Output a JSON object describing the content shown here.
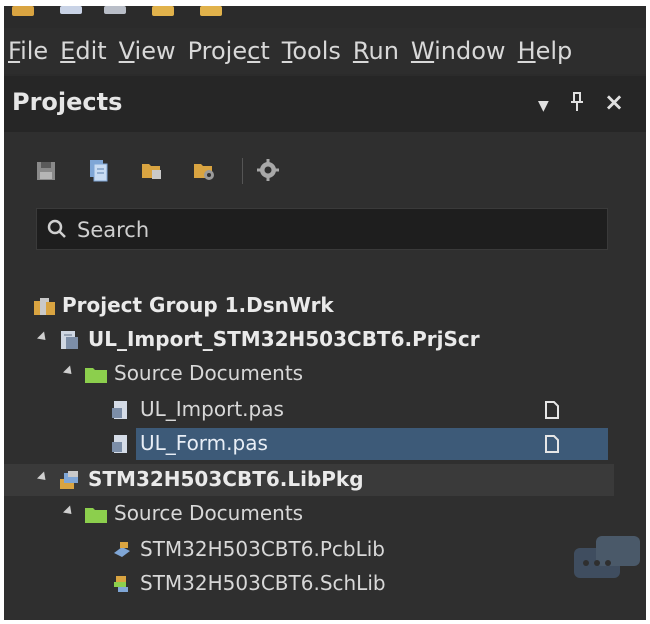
{
  "menubar": {
    "items": [
      {
        "first": "F",
        "rest": "ile"
      },
      {
        "first": "E",
        "rest": "dit"
      },
      {
        "first": "V",
        "rest": "iew"
      },
      {
        "first": "P",
        "rest": "roject"
      },
      {
        "first": "T",
        "rest": "ools"
      },
      {
        "first": "R",
        "rest": "un"
      },
      {
        "first": "W",
        "rest": "indow"
      },
      {
        "first": "H",
        "rest": "elp"
      }
    ]
  },
  "panel": {
    "title": "Projects",
    "menu_glyph": "▼",
    "pin_glyph": "🖈",
    "close_glyph": "×"
  },
  "toolbar": {
    "icons": [
      "save-icon",
      "copy-document-icon",
      "open-folder-icon",
      "folder-settings-icon",
      "gear-icon"
    ]
  },
  "search": {
    "placeholder": "Search"
  },
  "tree": {
    "group": "Project Group 1.DsnWrk",
    "project1": {
      "name": "UL_Import_STM32H503CBT6.PrjScr",
      "folder": "Source Documents",
      "files": [
        "UL_Import.pas",
        "UL_Form.pas"
      ]
    },
    "project2": {
      "name": "STM32H503CBT6.LibPkg",
      "folder": "Source Documents",
      "files": [
        "STM32H503CBT6.PcbLib",
        "STM32H503CBT6.SchLib"
      ]
    }
  },
  "colors": {
    "panel_bg": "#2f2f2f",
    "selection": "#3d5a78",
    "folder_green": "#8ccf4d",
    "text": "#d8d8d8"
  }
}
